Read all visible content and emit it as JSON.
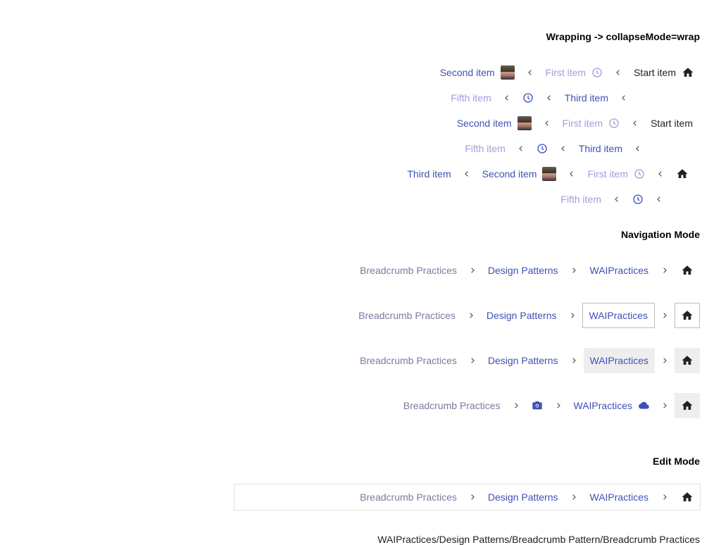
{
  "headings": {
    "wrapping": "Wrapping -> collapseMode=wrap",
    "navigation": "Navigation Mode",
    "edit": "Edit Mode"
  },
  "wrap": {
    "start": "Start item",
    "first": "First item",
    "second": "Second item",
    "third": "Third item",
    "fifth": "Fifth item"
  },
  "nav": {
    "waipractices": "WAIPractices",
    "design_patterns": "Design Patterns",
    "breadcrumb_practices": "Breadcrumb Practices"
  },
  "edit": {
    "waipractices": "WAIPractices",
    "design_patterns": "Design Patterns",
    "breadcrumb_practices": "Breadcrumb Practices",
    "path": "WAIPractices/Design Patterns/Breadcrumb Pattern/Breadcrumb Practices"
  },
  "colors": {
    "link": "#3f51b5",
    "disabled": "#9e9fd6",
    "text": "#212121"
  },
  "icons": [
    "home-icon",
    "clock-icon",
    "avatar-image",
    "camera-icon",
    "cloud-icon",
    "chevron-left-icon",
    "chevron-right-icon"
  ]
}
